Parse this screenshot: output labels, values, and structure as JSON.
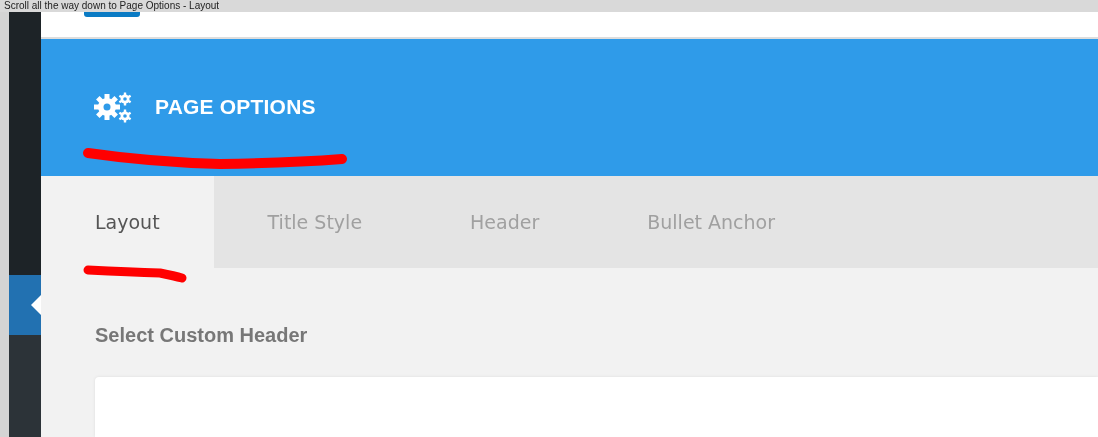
{
  "caption": "Scroll all the way down to Page Options - Layout",
  "panel": {
    "title": "PAGE OPTIONS"
  },
  "tabs": [
    {
      "label": "Layout",
      "selected": true
    },
    {
      "label": "Title Style",
      "selected": false
    },
    {
      "label": "Header",
      "selected": false
    },
    {
      "label": "Bullet Anchor",
      "selected": false
    }
  ],
  "field": {
    "label": "Select Custom Header"
  }
}
